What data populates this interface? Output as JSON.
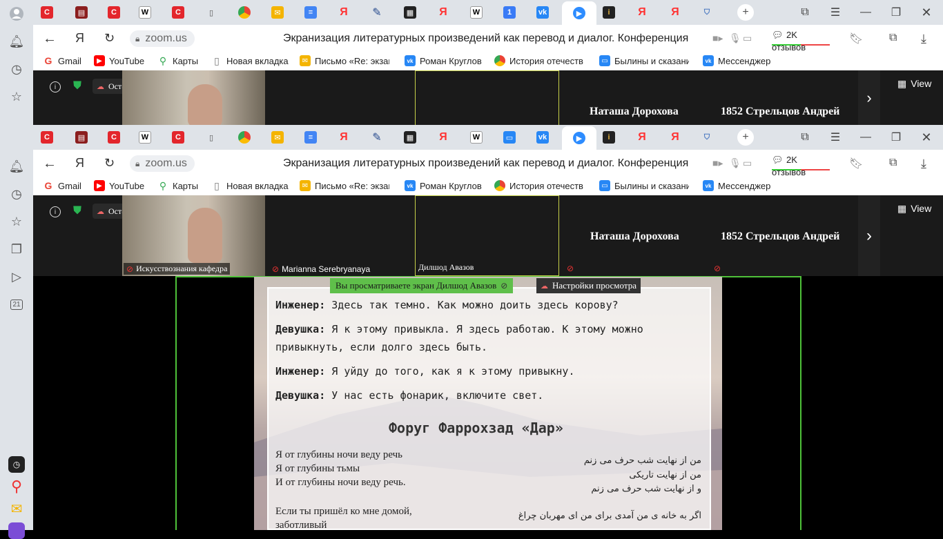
{
  "browser": {
    "url": "zoom.us",
    "title": "Экранизация литературных произведений как перевод и диалог. Конференция",
    "reviews": "2K отзывов"
  },
  "bookmarks": [
    {
      "label": "Gmail",
      "icon": "gmail-icon",
      "color": "#ea4335"
    },
    {
      "label": "YouTube",
      "icon": "youtube-icon",
      "color": "#ff0000"
    },
    {
      "label": "Карты",
      "icon": "maps-icon",
      "color": "#34a853"
    },
    {
      "label": "Новая вкладка",
      "icon": "page-icon",
      "color": "#777"
    },
    {
      "label": "Письмо «Re: экзам",
      "icon": "mail-icon",
      "color": "#f4b400"
    },
    {
      "label": "Роман Круглов",
      "icon": "vk-icon",
      "color": "#2787f5"
    },
    {
      "label": "История отечеств",
      "icon": "chrome-icon",
      "color": "#ea4335"
    },
    {
      "label": "Былины и сказани",
      "icon": "message-icon",
      "color": "#2787f5"
    },
    {
      "label": "Мессенджер",
      "icon": "vk-icon",
      "color": "#2787f5"
    }
  ],
  "sidebar_badge": "21",
  "zoom": {
    "recording_label": "Остановить запись",
    "view_label": "View",
    "participants": [
      {
        "name": "Искусствознания кафедра"
      },
      {
        "name": "Marianna Serebryanaya"
      },
      {
        "name": "Дилшод Авазов"
      },
      {
        "name": "Наташа Дорохова"
      },
      {
        "name": "1852 Стрельцов Андрей"
      }
    ],
    "share_banner": "Вы просматриваете экран Дилшод Авазов",
    "view_settings": "Настройки просмотра"
  },
  "slide": {
    "dialog": [
      {
        "speaker": "Инженер:",
        "text": " Здесь так темно. Как можно доить здесь корову?"
      },
      {
        "speaker": "Девушка:",
        "text": " Я к этому привыкла. Я здесь работаю. К этому можно"
      },
      {
        "speaker": "",
        "text": "привыкнуть, если долго здесь быть."
      },
      {
        "speaker": "Инженер:",
        "text": " Я уйду до того, как я к этому привыкну."
      },
      {
        "speaker": "Девушка:",
        "text": " У нас есть фонарик, включите свет."
      }
    ],
    "heading": "Форуг Фаррохзад «Дар»",
    "poem_ru": [
      "Я от глубины ночи веду речь",
      "Я от глубины тьмы",
      "И от глубины ночи веду речь.",
      "",
      "Если ты пришёл ко мне домой,",
      "заботливый"
    ],
    "poem_fa": [
      "من از نهایت شب حرف می زنم",
      "من از نهایت تاریکی",
      "و از نهایت شب حرف می زنم",
      "",
      "اگر به خانه ی من آمدی برای من ای مهربان چراغ"
    ]
  }
}
